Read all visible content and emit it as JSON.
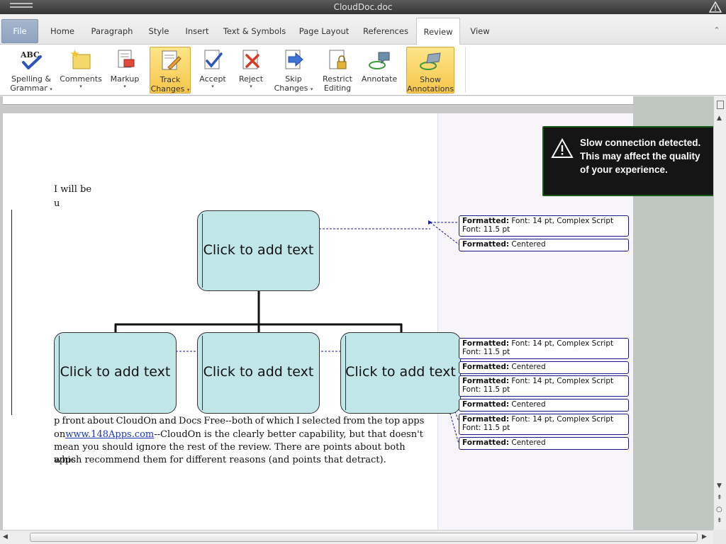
{
  "window": {
    "title": "CloudDoc.doc"
  },
  "tabs": [
    "File",
    "Home",
    "Paragraph",
    "Style",
    "Insert",
    "Text & Symbols",
    "Page Layout",
    "References",
    "Review",
    "View"
  ],
  "active_tab": "Review",
  "ribbon": {
    "spelling": [
      "Spelling &",
      "Grammar"
    ],
    "comments": "Comments",
    "markup": "Markup",
    "track": [
      "Track",
      "Changes"
    ],
    "accept": "Accept",
    "reject": "Reject",
    "skip": [
      "Skip",
      "Changes"
    ],
    "restrict": [
      "Restrict",
      "Editing"
    ],
    "annotate": "Annotate",
    "show": [
      "Show",
      "Annotations"
    ]
  },
  "document": {
    "line1": "I will  be",
    "line2": "u",
    "para_start": "p front  about  CloudOn  and  Docs  Free--both  of  which  I  selected  from  the  top  apps",
    "para_l2_pre": "on",
    "para_link": "www.148Apps.com",
    "para_l2_post": "--CloudOn  is  the  clearly  better  capability,  but  that  doesn't",
    "para_l3": "mean  you  should  ignore  the  rest  of  the  review.  There  are  points  about  both  apps",
    "para_l4": "which  recommend  them  for  different  reasons  (and  points  that  detract)."
  },
  "smartart": {
    "top": "Click to add text",
    "left": "Click to add text",
    "middle": "Click to add text",
    "right": "Click to add text"
  },
  "balloons": {
    "label": "Formatted:",
    "font": "Font: 14 pt, Complex Script Font: 11.5 pt",
    "align": "Centered"
  },
  "toast": {
    "message": "Slow connection detected. This may affect the quality of your experience."
  },
  "colors": {
    "accent_active": "#f7c64a",
    "smartart_fill": "#c1e6e8",
    "balloon_border": "#1a1a8c",
    "link": "#1a35b8"
  }
}
